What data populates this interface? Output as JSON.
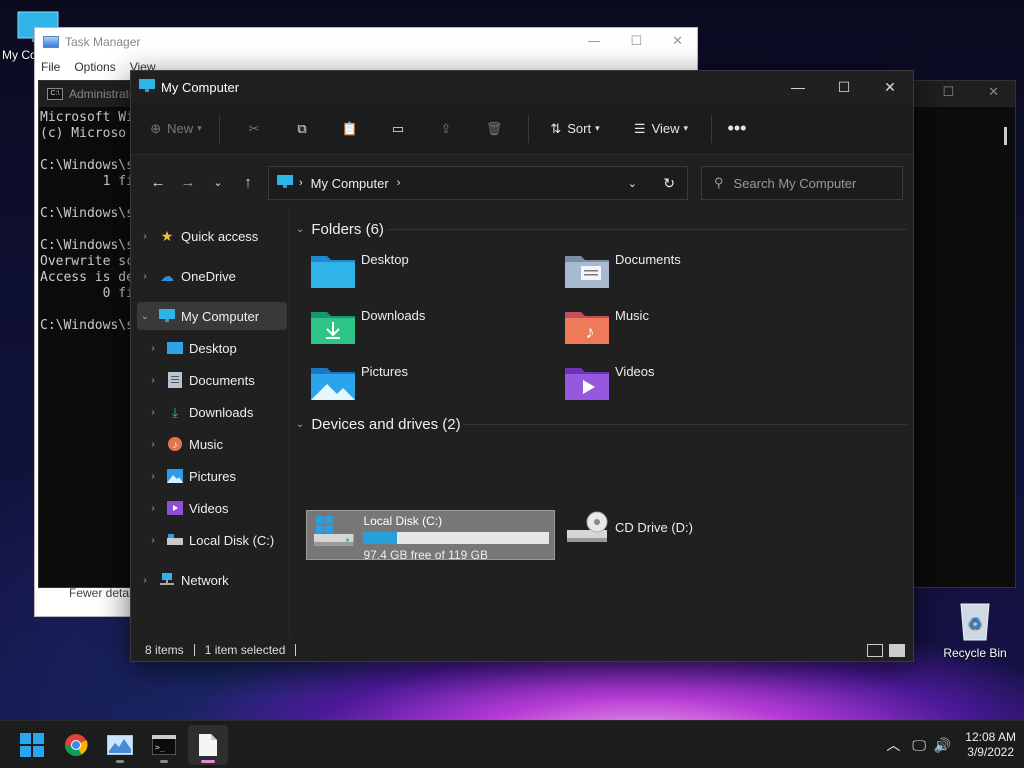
{
  "desktop": {
    "icons": [
      {
        "label": "My Computer",
        "icon": "monitor-icon"
      },
      {
        "label": "Recycle Bin",
        "icon": "recycle-bin-icon"
      }
    ]
  },
  "task_manager": {
    "title": "Task Manager",
    "menu": [
      "File",
      "Options",
      "View"
    ],
    "footer": "Fewer details"
  },
  "console": {
    "title": "Administrator",
    "lines": [
      "Microsoft Wi",
      "(c) Microso",
      "",
      "C:\\Windows\\s",
      "        1 fi",
      "",
      "C:\\Windows\\s",
      "",
      "C:\\Windows\\s",
      "Overwrite sc",
      "Access is de",
      "        0 fi",
      "",
      "C:\\Windows\\s"
    ]
  },
  "explorer": {
    "title": "My Computer",
    "toolbar": {
      "new_label": "New",
      "sort_label": "Sort",
      "view_label": "View"
    },
    "address": {
      "location": "My Computer"
    },
    "search": {
      "placeholder": "Search My Computer"
    },
    "nav": {
      "quick_access": "Quick access",
      "onedrive": "OneDrive",
      "my_computer": "My Computer",
      "children": [
        "Desktop",
        "Documents",
        "Downloads",
        "Music",
        "Pictures",
        "Videos",
        "Local Disk (C:)"
      ],
      "network": "Network"
    },
    "folders_header": "Folders (6)",
    "folders": [
      "Desktop",
      "Documents",
      "Downloads",
      "Music",
      "Pictures",
      "Videos"
    ],
    "devices_header": "Devices and drives (2)",
    "drives": [
      {
        "name": "Local Disk (C:)",
        "free": "97.4 GB free of 119 GB",
        "used_fraction": 0.18
      },
      {
        "name": "CD Drive (D:)"
      }
    ],
    "status": {
      "items": "8 items",
      "selected": "1 item selected"
    }
  },
  "taskbar": {
    "apps": [
      "start-icon",
      "chrome-icon",
      "task-manager-icon",
      "terminal-icon",
      "file-icon"
    ],
    "clock_time": "12:08 AM",
    "clock_date": "3/9/2022"
  },
  "colors": {
    "accent": "#26a0da",
    "window_bg": "#202020",
    "selection": "#777777"
  }
}
